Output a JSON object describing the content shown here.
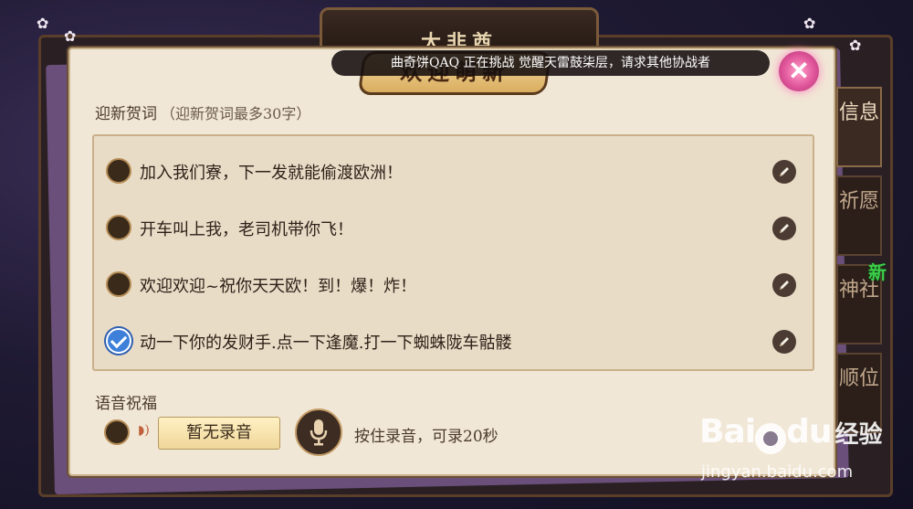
{
  "top_plaque": {
    "title": "大非酋"
  },
  "dialog": {
    "title": "欢迎萌新",
    "close_label": "✕"
  },
  "marquee": {
    "text": "曲奇饼QAQ 正在挑战 觉醒天雷鼓柒层，请求其他协战者"
  },
  "greeting_section": {
    "label": "迎新贺词",
    "hint": "（迎新贺词最多30字）",
    "items": [
      {
        "text": "加入我们寮，下一发就能偷渡欧洲！",
        "selected": false
      },
      {
        "text": "开车叫上我，老司机带你飞！",
        "selected": false
      },
      {
        "text": "欢迎欢迎~祝你天天欧！到！爆！炸！",
        "selected": false
      },
      {
        "text": "动一下你的发财手.点一下逢魔.打一下蜘蛛陇车骷髅",
        "selected": true
      }
    ]
  },
  "voice_section": {
    "label": "语音祝福",
    "no_recording": "暂无录音",
    "hint": "按住录音，可录20秒"
  },
  "side_tabs": [
    {
      "label": "信息",
      "active": true
    },
    {
      "label": "祈愿",
      "active": false
    },
    {
      "label": "神社",
      "active": false
    },
    {
      "label": "顺位",
      "active": false
    }
  ],
  "new_badge": "新",
  "watermark": {
    "brand_a": "Bai",
    "brand_b": "du",
    "brand_cn": "经验",
    "url": "jingyan.baidu.com"
  },
  "colors": {
    "accent_pink": "#e0559a",
    "check_blue": "#3d7fd9",
    "badge_green": "#3bd14a"
  }
}
